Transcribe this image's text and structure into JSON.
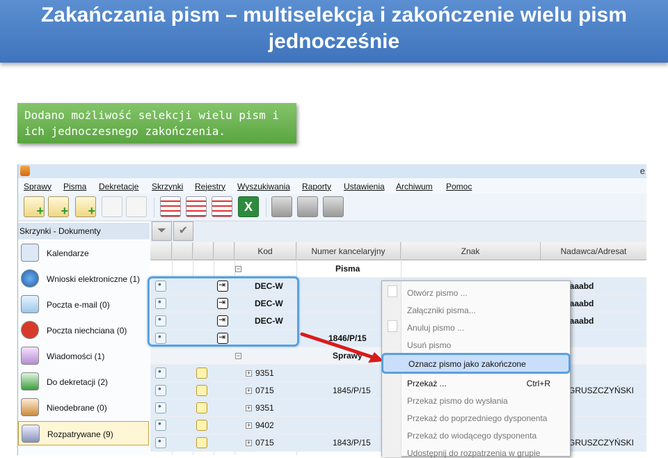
{
  "slide": {
    "title": "Zakańczania pism – multiselekcja i zakończenie wielu pism jednocześnie",
    "note": "Dodano możliwość selekcji wielu pism i ich jednoczesnego zakończenia."
  },
  "app": {
    "titlebar_text": "e",
    "menu": [
      "Sprawy",
      "Pisma",
      "Dekretacje",
      "Skrzynki",
      "Rejestry",
      "Wyszukiwania",
      "Raporty",
      "Ustawienia",
      "Archiwum",
      "Pomoc"
    ],
    "sidebar": {
      "header": "Skrzynki - Dokumenty",
      "items": [
        {
          "label": "Kalendarze",
          "icon": "calendar-icon"
        },
        {
          "label": "Wnioski elektroniczne (1)",
          "icon": "globe-icon"
        },
        {
          "label": "Poczta e-mail (0)",
          "icon": "email-icon"
        },
        {
          "label": "Poczta niechciana (0)",
          "icon": "stop-icon"
        },
        {
          "label": "Wiadomości (1)",
          "icon": "chat-icon"
        },
        {
          "label": "Do dekretacji (2)",
          "icon": "tree-icon"
        },
        {
          "label": "Nieodebrane (0)",
          "icon": "package-icon"
        },
        {
          "label": "Rozpatrywane (9)",
          "icon": "gear-icon"
        }
      ]
    },
    "grid": {
      "columns": [
        "Kod",
        "Numer kancelaryjny",
        "Znak",
        "Nadawca/Adresat"
      ],
      "group_pisma": "Pisma",
      "group_sprawy": "Sprawy",
      "pisma_rows": [
        {
          "kod": "DEC-W",
          "numer": "",
          "adresat": "aaaabd"
        },
        {
          "kod": "DEC-W",
          "numer": "",
          "adresat": "aaaabd"
        },
        {
          "kod": "DEC-W",
          "numer": "",
          "adresat": "aaaabd"
        },
        {
          "kod": "",
          "numer": "1846/P/15",
          "adresat": ""
        }
      ],
      "sprawy_rows": [
        {
          "kod": "9351",
          "numer": "",
          "adresat": ""
        },
        {
          "kod": "0715",
          "numer": "1845/P/15",
          "adresat": "GRUSZCZYŃSKI"
        },
        {
          "kod": "9351",
          "numer": "",
          "adresat": ""
        },
        {
          "kod": "9402",
          "numer": "",
          "adresat": ""
        },
        {
          "kod": "0715",
          "numer": "1843/P/15",
          "adresat": "GRUSZCZYŃSKI"
        }
      ]
    },
    "context_menu": {
      "items": [
        {
          "label": "Otwórz pismo ...",
          "enabled": false
        },
        {
          "label": "Załączniki pisma...",
          "enabled": false
        },
        {
          "label": "Anuluj pismo ...",
          "enabled": false
        },
        {
          "label": "Usuń pismo",
          "enabled": false
        },
        {
          "label": "Oznacz pismo jako zakończone",
          "enabled": true,
          "selected": true
        },
        {
          "label": "Przekaż ...",
          "enabled": true,
          "shortcut": "Ctrl+R"
        },
        {
          "label": "Przekaż pismo do wysłania",
          "enabled": false
        },
        {
          "label": "Przekaż do poprzedniego dysponenta",
          "enabled": false
        },
        {
          "label": "Przekaż do wiodącego dysponenta",
          "enabled": false
        },
        {
          "label": "Udostępnij do rozpatrzenia w grupie",
          "enabled": false
        }
      ]
    },
    "colors": {
      "highlight": "#5aa0dd",
      "arrow": "#d91b1b",
      "note_bg": "#6cb452",
      "title_bg": "#4a80c6"
    }
  }
}
